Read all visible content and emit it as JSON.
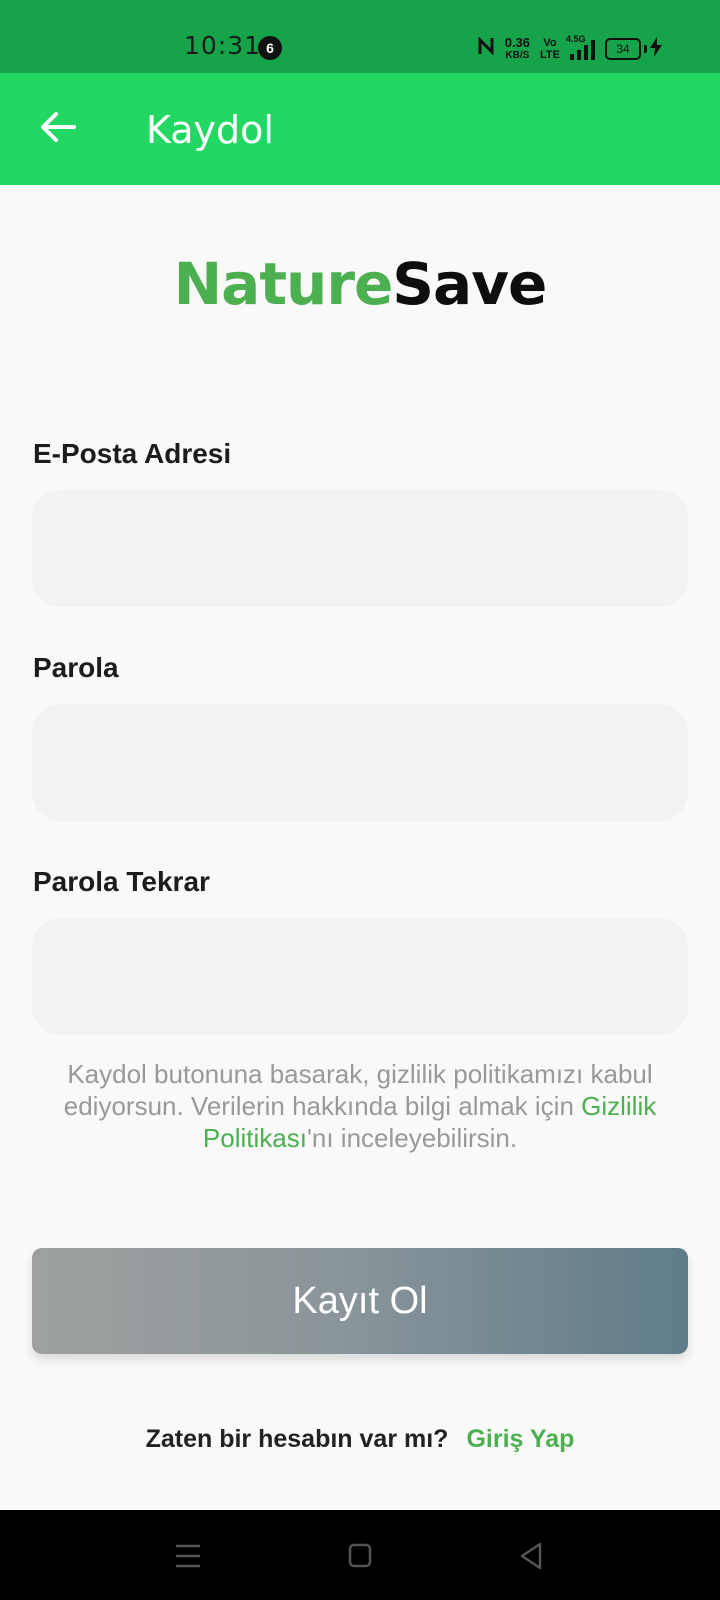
{
  "status_bar": {
    "time": "10:31",
    "notification_count": "6",
    "net_speed_value": "0.36",
    "net_speed_unit": "KB/S",
    "volte_top": "Vo",
    "volte_bottom": "LTE",
    "signal_type": "4.5G",
    "battery": "34",
    "bg_color": "#16a34a"
  },
  "app_bar": {
    "title": "Kaydol",
    "back_icon": "arrow-left-icon",
    "bg_color": "#22d862"
  },
  "logo": {
    "part1": "Nature",
    "part2": "Save",
    "accent": "#4caf50"
  },
  "form": {
    "email_label": "E-Posta Adresi",
    "email_value": "",
    "password_label": "Parola",
    "password_value": "",
    "password_repeat_label": "Parola Tekrar",
    "password_repeat_value": ""
  },
  "policy": {
    "text_before": "Kaydol butonuna basarak, gizlilik politikamızı kabul ediyorsun. Verilerin hakkında bilgi almak için ",
    "link_text": "Gizlilik Politikası",
    "text_after": "'nı inceleyebilirsin."
  },
  "register_button": {
    "label": "Kayıt Ol"
  },
  "login_prompt": {
    "question": "Zaten bir hesabın var mı?",
    "link": "Giriş Yap"
  },
  "nav_bar": {
    "menu_icon": "menu-icon",
    "home_icon": "square-home-icon",
    "back_icon": "triangle-back-icon"
  }
}
